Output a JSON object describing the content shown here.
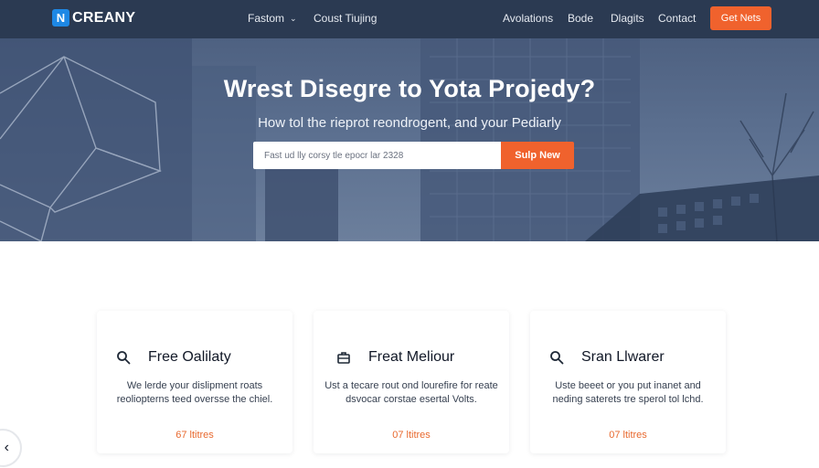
{
  "colors": {
    "nav_bg": "#2b3a52",
    "accent": "#f0622d",
    "logo_blue": "#1e88e5"
  },
  "nav": {
    "logo_mark": "N",
    "logo_text": "CREANY",
    "links": [
      {
        "label": "Fastom",
        "has_dropdown": true
      },
      {
        "label": "Coust Tiujing"
      },
      {
        "label": "Avolations"
      },
      {
        "label": "Bode"
      },
      {
        "label": "Dlagits"
      },
      {
        "label": "Contact"
      }
    ],
    "cta_label": "Get Nets"
  },
  "hero": {
    "title": "Wrest Disegre to Yota Projedy?",
    "subtitle": "How tol the rieprot reondrogent, and your Pediarly",
    "signup_placeholder": "Fast ud lly corsy tle epocr lar 2328",
    "signup_button": "Sulp New"
  },
  "features": [
    {
      "icon": "search-icon",
      "title": "Free Oalilaty",
      "description": "We lerde your dislipment roats reoliopterns teed oversse the chiel.",
      "link": "67 ltitres"
    },
    {
      "icon": "briefcase-icon",
      "title": "Freat Meliour",
      "description": "Ust a tecare rout ond lourefire for reate dsvocar corstae esertal Volts.",
      "link": "07 ltitres"
    },
    {
      "icon": "search-icon",
      "title": "Sran Llwarer",
      "description": "Uste beeet or you put inanet and neding saterets tre sperol tol lchd.",
      "link": "07 ltitres"
    }
  ],
  "back_button": {
    "icon": "chevron-left-icon"
  }
}
